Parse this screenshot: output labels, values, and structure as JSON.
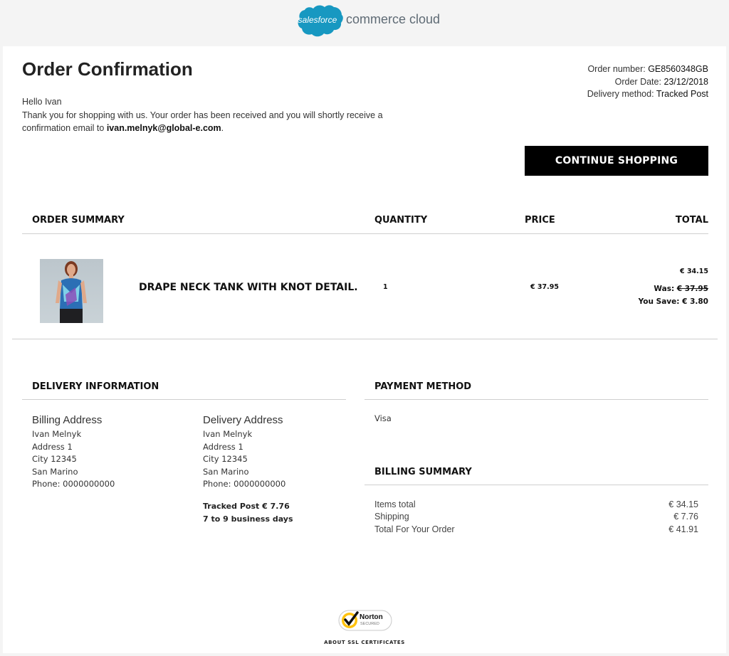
{
  "brand": {
    "cloud_text": "salesforce",
    "product_text": "commerce cloud",
    "color": "#1798c1"
  },
  "header": {
    "title": "Order Confirmation",
    "greeting": "Hello Ivan",
    "thanks_text": "Thank you for shopping with us. Your order has been received and you will shortly receive a confirmation email to ",
    "email": "ivan.melnyk@global-e.com",
    "email_suffix": "."
  },
  "order_meta": {
    "number_label": "Order number:",
    "number_value": "GE8560348GB",
    "date_label": "Order Date:",
    "date_value": "23/12/2018",
    "delivery_label": "Delivery method:",
    "delivery_value": "Tracked Post"
  },
  "actions": {
    "continue_label": "CONTINUE SHOPPING"
  },
  "summary": {
    "headers": {
      "item": "ORDER SUMMARY",
      "quantity": "QUANTITY",
      "price": "PRICE",
      "total": "TOTAL"
    },
    "item": {
      "name": "DRAPE NECK TANK WITH KNOT DETAIL.",
      "quantity": "1",
      "price": "€ 37.95",
      "total": "€ 34.15",
      "was_label": "Was:",
      "was_value": "€ 37.95",
      "save_label": "You Save:",
      "save_value": "€ 3.80"
    }
  },
  "delivery": {
    "heading": "DELIVERY INFORMATION",
    "billing": {
      "title": "Billing Address",
      "lines": [
        "Ivan Melnyk",
        "Address 1",
        "City 12345",
        "San Marino",
        "Phone: 0000000000"
      ]
    },
    "shipping": {
      "title": "Delivery Address",
      "lines": [
        "Ivan Melnyk",
        "Address 1",
        "City 12345",
        "San Marino",
        "Phone: 0000000000"
      ],
      "method": "Tracked Post € 7.76",
      "eta": "7 to 9 business days"
    }
  },
  "payment": {
    "heading": "PAYMENT METHOD",
    "method": "Visa"
  },
  "billing_summary": {
    "heading": "BILLING SUMMARY",
    "rows": [
      {
        "label": "Items total",
        "value": "€ 34.15"
      },
      {
        "label": "Shipping",
        "value": "€ 7.76"
      },
      {
        "label": "Total For Your Order",
        "value": "€ 41.91"
      }
    ]
  },
  "footer": {
    "norton_text": "Norton",
    "norton_sub": "SECURED",
    "ssl_link": "ABOUT SSL CERTIFICATES"
  }
}
